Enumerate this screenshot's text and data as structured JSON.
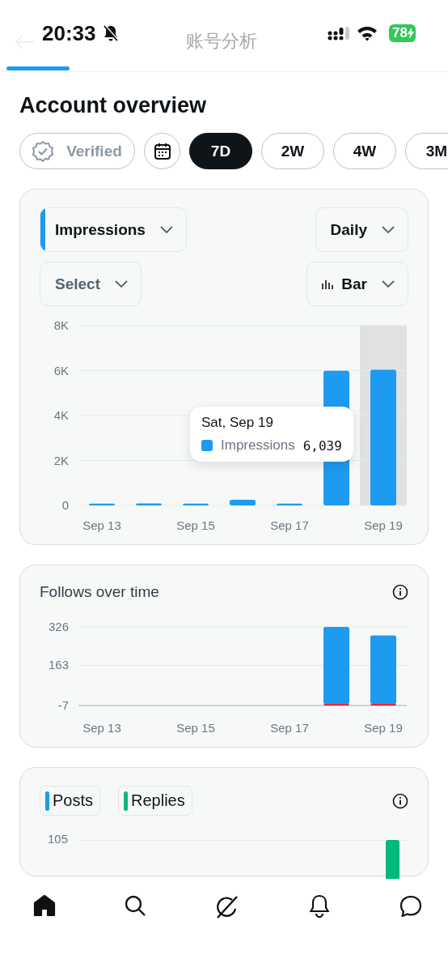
{
  "status_bar": {
    "time": "20:33",
    "battery": "78"
  },
  "header": {
    "title": "账号分析"
  },
  "page_title": "Account overview",
  "filters": [
    {
      "kind": "badge",
      "label": "Verified"
    },
    {
      "kind": "calendar"
    },
    {
      "kind": "range",
      "label": "7D",
      "selected": true
    },
    {
      "kind": "range",
      "label": "2W",
      "selected": false
    },
    {
      "kind": "range",
      "label": "4W",
      "selected": false
    },
    {
      "kind": "range",
      "label": "3M",
      "selected": false
    }
  ],
  "impressions_card": {
    "interval": "Daily",
    "compare": "Select",
    "chart_type": "Bar",
    "chart_data": {
      "type": "bar",
      "categories": [
        "Sep 13",
        null,
        "Sep 15",
        null,
        "Sep 17",
        null,
        "Sep 19"
      ],
      "series": [
        {
          "name": "Impressions",
          "color": "#1d9bf0",
          "values": [
            80,
            90,
            80,
            250,
            80,
            5990,
            6039
          ]
        }
      ],
      "grid": true,
      "ylim": [
        0,
        8000
      ],
      "yticks": [
        {
          "value": 0,
          "label": "0"
        },
        {
          "value": 2000,
          "label": "2K"
        },
        {
          "value": 4000,
          "label": "4K"
        },
        {
          "value": 6000,
          "label": "6K"
        },
        {
          "value": 8000,
          "label": "8K"
        }
      ]
    },
    "tooltip": {
      "title": "Sat, Sep 19",
      "label": "Impressions",
      "value": "6,039",
      "color": "#1d9bf0"
    }
  },
  "follows_card": {
    "title": "Follows over time",
    "chart_data": {
      "type": "bar",
      "stacked": true,
      "categories": [
        "Sep 13",
        null,
        "Sep 15",
        null,
        "Sep 17",
        null,
        "Sep 19"
      ],
      "series": [
        {
          "color": "#1d9bf0",
          "values": [
            0,
            0,
            0,
            0,
            0,
            326,
            290
          ]
        },
        {
          "color": "#f4212e",
          "values": [
            0,
            0,
            0,
            0,
            0,
            -7,
            -7
          ]
        }
      ],
      "ylim": [
        -7,
        326
      ],
      "yticks": [
        -7,
        163,
        326
      ],
      "grid": true
    }
  },
  "posts_card": {
    "legend": [
      {
        "label": "Posts",
        "color": "#1d9bf0"
      },
      {
        "label": "Replies",
        "color": "#00ba7c"
      }
    ],
    "ytick": "105"
  },
  "bottom_nav": [
    {
      "kind": "home",
      "selected": true
    },
    {
      "kind": "search",
      "selected": false
    },
    {
      "kind": "grok",
      "selected": false
    },
    {
      "kind": "bell",
      "selected": false
    },
    {
      "kind": "chat",
      "selected": false
    }
  ]
}
